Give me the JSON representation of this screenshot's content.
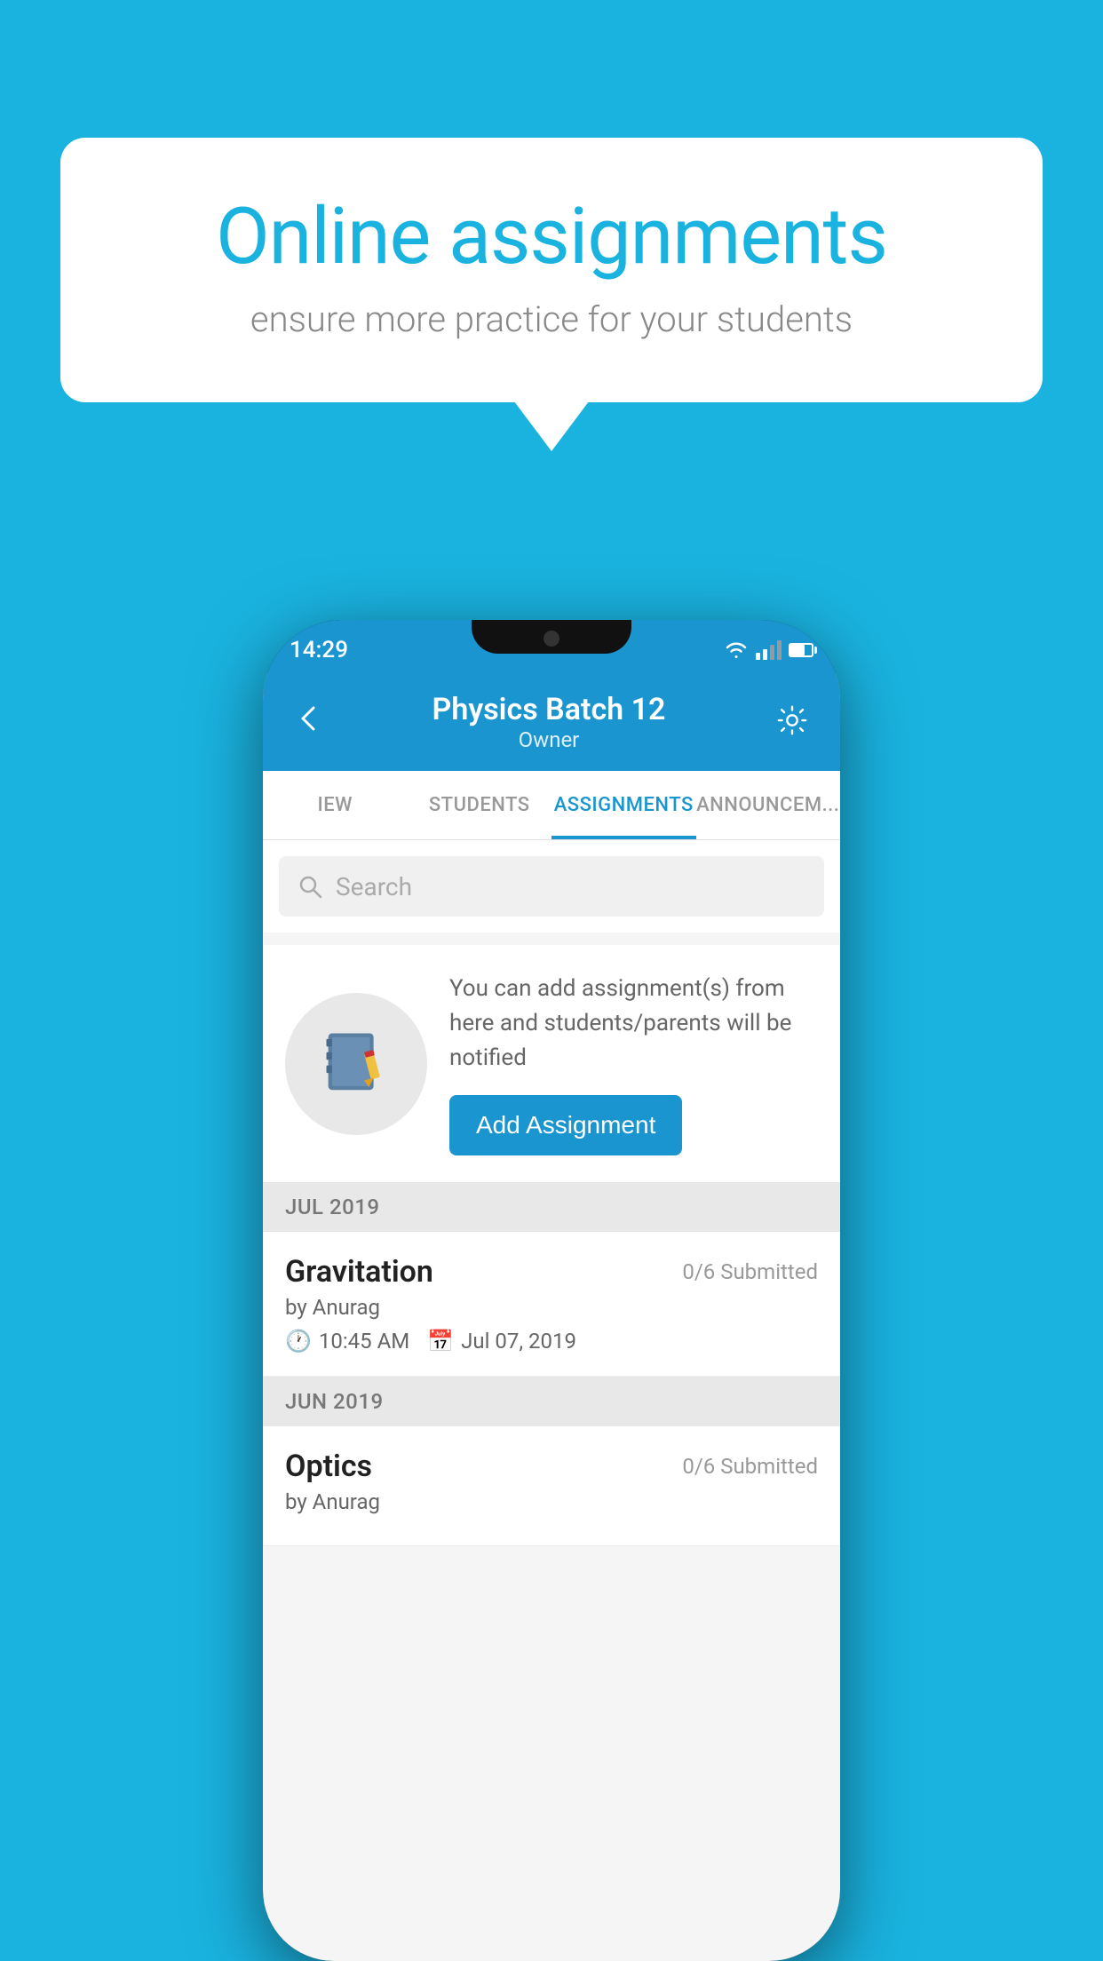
{
  "background": {
    "color": "#1ab3e0"
  },
  "speech_bubble": {
    "title": "Online assignments",
    "subtitle": "ensure more practice for your students"
  },
  "status_bar": {
    "time": "14:29"
  },
  "app_header": {
    "title": "Physics Batch 12",
    "subtitle": "Owner",
    "back_label": "←"
  },
  "tabs": [
    {
      "label": "IEW",
      "active": false
    },
    {
      "label": "STUDENTS",
      "active": false
    },
    {
      "label": "ASSIGNMENTS",
      "active": true
    },
    {
      "label": "ANNOUNCEM...",
      "active": false
    }
  ],
  "search": {
    "placeholder": "Search"
  },
  "promo": {
    "description": "You can add assignment(s) from here and students/parents will be notified",
    "button_label": "Add Assignment"
  },
  "sections": [
    {
      "month": "JUL 2019",
      "assignments": [
        {
          "name": "Gravitation",
          "submitted": "0/6 Submitted",
          "by": "by Anurag",
          "time": "10:45 AM",
          "date": "Jul 07, 2019"
        }
      ]
    },
    {
      "month": "JUN 2019",
      "assignments": [
        {
          "name": "Optics",
          "submitted": "0/6 Submitted",
          "by": "by Anurag",
          "time": "",
          "date": ""
        }
      ]
    }
  ]
}
